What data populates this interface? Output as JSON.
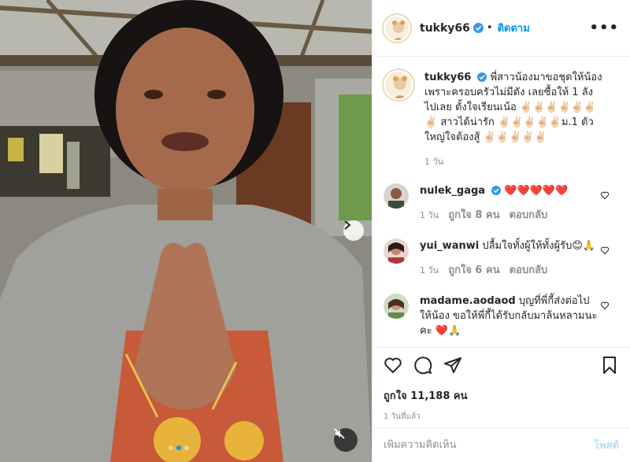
{
  "post": {
    "author": "tukky66",
    "follow_label": "ติดตาม",
    "more_label": "•••",
    "caption": "พี่สาวน้องมาขอชุดให้น้อง เพราะครอบครัวไม่มีตัง เลยซื้อให้ 1 ลัง ไปเลย ตั้งใจเรียนเน้อ ✌🏻✌🏻✌🏻✌🏻✌🏻✌🏻✌🏻 สาวได้น่ารัก ✌🏻✌🏻✌🏻✌🏻✌🏻ม.1 ตัวใหญ่ใจต้องสู้ ✌🏻✌🏻✌🏻✌🏻✌🏻",
    "caption_age": "1 วัน",
    "likes": "ถูกใจ 11,188 คน",
    "time_ago": "1 วันที่แล้ว"
  },
  "comments": [
    {
      "user": "nulek_gaga",
      "verified": true,
      "text": "❤️❤️❤️❤️❤️",
      "age": "1 วัน",
      "likes": "ถูกใจ 8 คน",
      "reply": "ตอบกลับ"
    },
    {
      "user": "yui_wanwi",
      "verified": false,
      "text": "ปลื้มใจทั้งผู้ให้ทั้งผู้รับ😊🙏",
      "age": "1 วัน",
      "likes": "ถูกใจ 6 คน",
      "reply": "ตอบกลับ"
    },
    {
      "user": "madame.aodaod",
      "verified": false,
      "text": "บุญที่พี่กี้ส่งต่อไปให้น้อง ขอให้พี่กี้ได้รับกลับมาล้นหลามนะคะ ❤️🙏",
      "age": "",
      "likes": "",
      "reply": ""
    }
  ],
  "add_comment": {
    "placeholder": "เพิ่มความคิดเห็น",
    "post_label": "โพสต์"
  },
  "colors": {
    "accent": "#0095f6",
    "verified": "#3897f0",
    "muted": "#8e8e8e",
    "border": "#efefef"
  },
  "icons": [
    "heart-icon",
    "comment-icon",
    "share-icon",
    "bookmark-icon",
    "mute-icon",
    "chevron-right-icon"
  ]
}
